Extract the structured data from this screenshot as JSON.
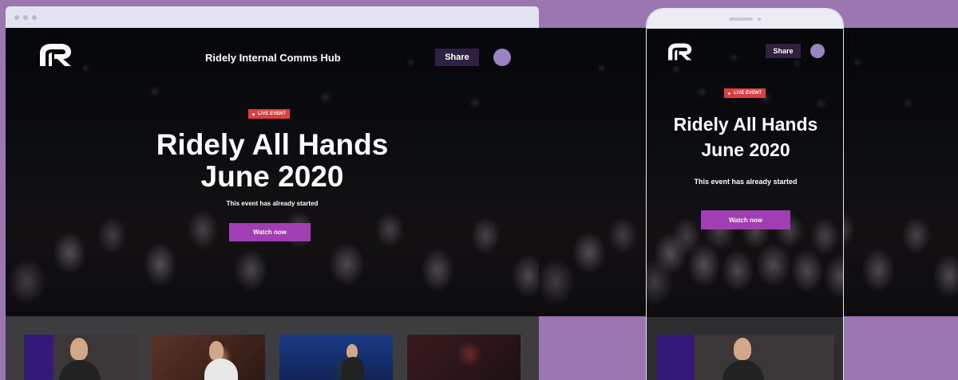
{
  "brand": {
    "logo_text": "R",
    "accent": "#a23eb3",
    "live_color": "#e23d3d",
    "share_bg": "#2e2240",
    "page_bg": "#9b76b0"
  },
  "desktop": {
    "hub_title": "Ridely Internal Comms Hub",
    "share_label": "Share",
    "live_label": "LIVE EVENT",
    "event_title_line1": "Ridely All Hands",
    "event_title_line2": "June 2020",
    "status_text": "This event has already started",
    "watch_label": "Watch now",
    "thumbnails": [
      "speaker-with-mic",
      "audience-question",
      "stage-presenter",
      "dark-stage-crowd"
    ]
  },
  "mobile": {
    "share_label": "Share",
    "live_label": "LIVE EVENT",
    "event_title_line1": "Ridely All Hands",
    "event_title_line2": "June 2020",
    "status_text": "This event has already started",
    "watch_label": "Watch now"
  },
  "icons": {
    "logo": "ridely-logo-icon",
    "avatar": "user-avatar",
    "live_dot": "live-dot-icon"
  }
}
